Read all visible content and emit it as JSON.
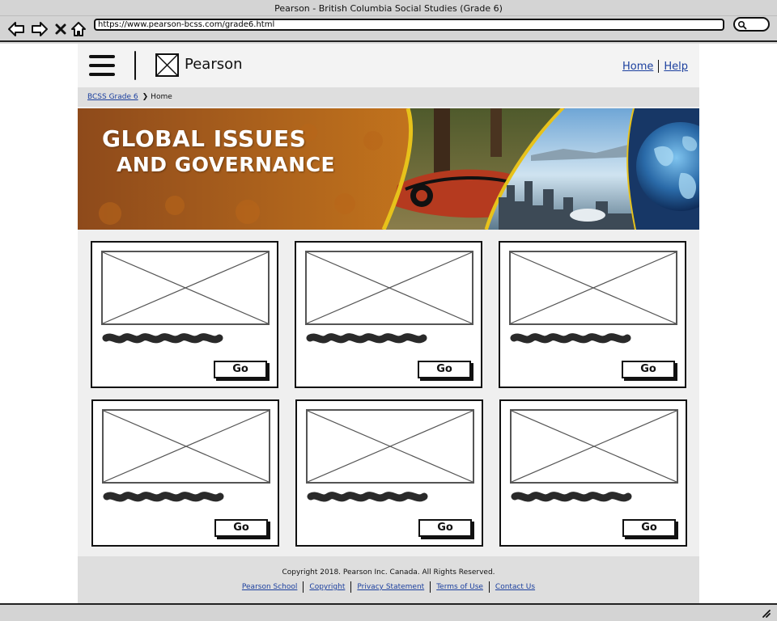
{
  "browser": {
    "title": "Pearson - British Columbia Social Studies (Grade 6)",
    "url": "https://www.pearson-bcss.com/grade6.html"
  },
  "header": {
    "logo_text": "Pearson",
    "nav": [
      "Home",
      "Help"
    ]
  },
  "breadcrumb": {
    "parent": "BCSS Grade 6",
    "current": "Home"
  },
  "banner": {
    "line1": "GLOBAL ISSUES",
    "line2": "AND GOVERNANCE"
  },
  "cards": [
    {
      "button_label": "Go"
    },
    {
      "button_label": "Go"
    },
    {
      "button_label": "Go"
    },
    {
      "button_label": "Go"
    },
    {
      "button_label": "Go"
    },
    {
      "button_label": "Go"
    }
  ],
  "footer": {
    "copyright": "Copyright 2018. Pearson Inc. Canada. All Rights Reserved.",
    "links": [
      "Pearson School",
      "Copyright",
      "Privacy Statement",
      "Terms of Use",
      "Contact Us"
    ]
  },
  "icons": {
    "back": "arrow-left-icon",
    "forward": "arrow-right-icon",
    "stop": "close-icon",
    "home": "home-icon",
    "search": "search-icon",
    "menu": "hamburger-icon",
    "logo_placeholder": "image-placeholder-icon",
    "resize": "resize-grip-icon"
  },
  "colors": {
    "link": "#1b3f9e",
    "banner_orange": "#c8781d",
    "banner_accent": "#e7c21b"
  }
}
